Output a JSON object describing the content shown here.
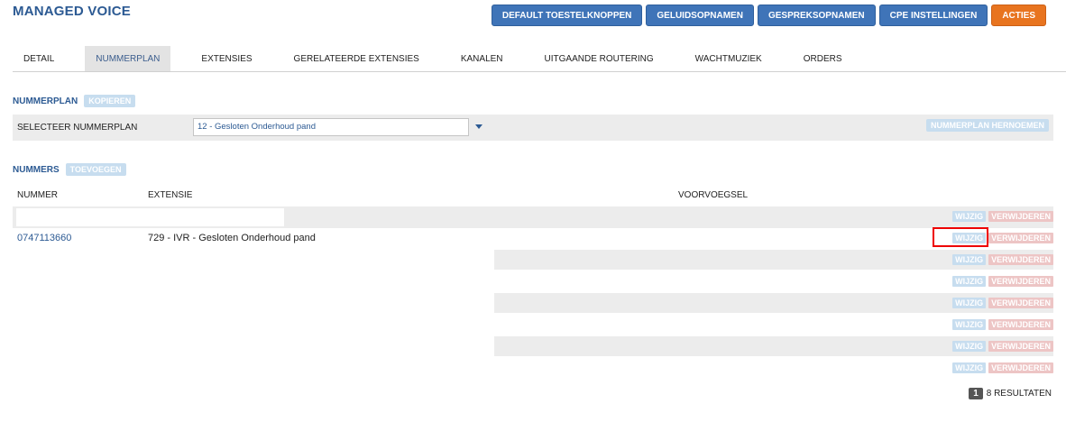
{
  "header": {
    "title": "MANAGED VOICE"
  },
  "top_buttons": [
    {
      "label": "DEFAULT TOESTELKNOPPEN"
    },
    {
      "label": "GELUIDSOPNAMEN"
    },
    {
      "label": "GESPREKSOPNAMEN"
    },
    {
      "label": "CPE INSTELLINGEN"
    },
    {
      "label": "ACTIES"
    }
  ],
  "tabs": [
    {
      "label": "DETAIL"
    },
    {
      "label": "NUMMERPLAN",
      "active": true
    },
    {
      "label": "EXTENSIES"
    },
    {
      "label": "GERELATEERDE EXTENSIES"
    },
    {
      "label": "KANALEN"
    },
    {
      "label": "UITGAANDE ROUTERING"
    },
    {
      "label": "WACHTMUZIEK"
    },
    {
      "label": "ORDERS"
    }
  ],
  "nummerplan": {
    "section_label": "NUMMERPLAN",
    "copy_label": "KOPIEREN",
    "select_label": "SELECTEER NUMMERPLAN",
    "selected": "12 - Gesloten Onderhoud pand",
    "rename_label": "NUMMERPLAN HERNOEMEN"
  },
  "nummers": {
    "section_label": "NUMMERS",
    "add_label": "TOEVOEGEN",
    "columns": [
      "NUMMER",
      "EXTENSIE",
      "VOORVOEGSEL"
    ],
    "rows": [
      {
        "nummer": "",
        "extensie": ""
      },
      {
        "nummer": "0747113660",
        "extensie": "729 - IVR - Gesloten Onderhoud pand"
      },
      {
        "nummer": "",
        "extensie": ""
      },
      {
        "nummer": "",
        "extensie": ""
      },
      {
        "nummer": "",
        "extensie": ""
      },
      {
        "nummer": "",
        "extensie": ""
      },
      {
        "nummer": "",
        "extensie": ""
      },
      {
        "nummer": "",
        "extensie": ""
      }
    ],
    "edit_label": "WIJZIG",
    "delete_label": "VERWIJDEREN"
  },
  "pager": {
    "page": "1",
    "results": "8 RESULTATEN"
  },
  "colors": {
    "brand_blue": "#2c5a93",
    "button_blue": "#3f74b8",
    "accent_orange": "#e8741f",
    "highlight_red": "#ee0000"
  }
}
